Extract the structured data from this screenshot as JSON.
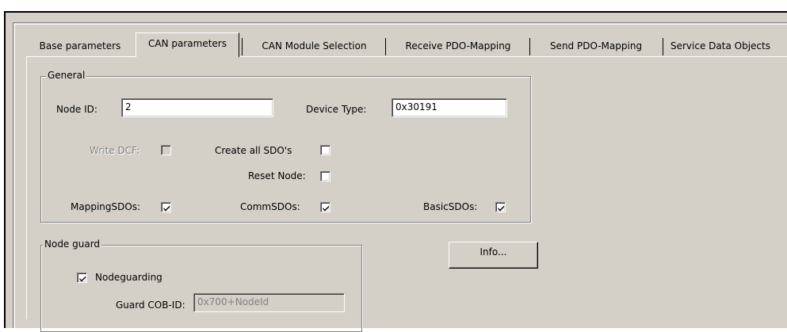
{
  "tabs": [
    {
      "label": "Base parameters",
      "active": false
    },
    {
      "label": "CAN parameters",
      "active": true
    },
    {
      "label": "CAN Module Selection",
      "active": false
    },
    {
      "label": "Receive PDO-Mapping",
      "active": false
    },
    {
      "label": "Send PDO-Mapping",
      "active": false
    },
    {
      "label": "Service Data Objects",
      "active": false
    }
  ],
  "general": {
    "legend": "General",
    "node_id_label": "Node ID:",
    "node_id_value": "2",
    "device_type_label": "Device Type:",
    "device_type_value": "0x30191",
    "write_dcf_label": "Write DCF:",
    "create_all_sdos_label": "Create all SDO's",
    "reset_node_label": "Reset Node:",
    "mapping_sdos_label": "MappingSDOs:",
    "comm_sdos_label": "CommSDOs:",
    "basic_sdos_label": "BasicSDOs:",
    "write_dcf_checked": false,
    "create_all_sdos_checked": false,
    "reset_node_checked": false,
    "mapping_sdos_checked": true,
    "comm_sdos_checked": true,
    "basic_sdos_checked": true
  },
  "node_guard": {
    "legend": "Node guard",
    "nodeguarding_label": "Nodeguarding",
    "nodeguarding_checked": true,
    "guard_cob_id_label": "Guard COB-ID:",
    "guard_cob_id_value": "0x700+NodeId"
  },
  "info_button": "Info..."
}
